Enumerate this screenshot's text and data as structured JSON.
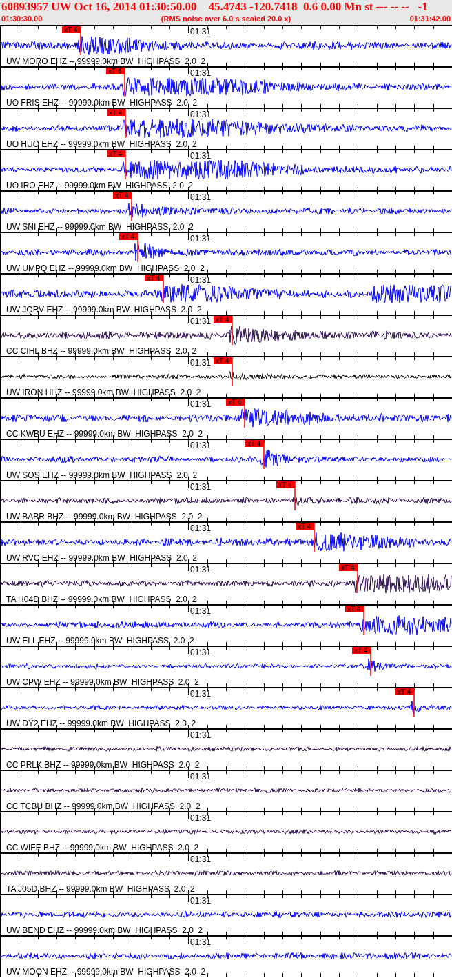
{
  "header": {
    "title": "60893957 UW Oct 16, 2014 01:30:50.00    45.4743 -120.7418  0.6 0.00 Mn st --- -- --   -1",
    "start_time": "01:30:30.00",
    "caption": "(RMS noise over 6.0 s scaled 20.0 x)",
    "end_time": "01:31:42.00"
  },
  "traces": [
    {
      "label": "UW MORO EHZ -- 99999.0km BW  HIGHPASS  2.0  2",
      "time_label": "01:31",
      "pick": "xT 4",
      "color": "#0000ff"
    },
    {
      "label": "UO FRIS EHZ -- 99999.0km BW  HIGHPASS  2.0  2",
      "time_label": "01:31",
      "pick": "xT 4",
      "color": "#0000ff"
    },
    {
      "label": "UO HUO EHZ -- 99999.0km BW  HIGHPASS  2.0  2",
      "time_label": "01:31",
      "pick": "xT 4",
      "color": "#0000ff"
    },
    {
      "label": "UO IRO EHZ -- 99999.0km BW  HIGHPASS  2.0  2",
      "time_label": "01:31",
      "pick": "xT 4",
      "color": "#0000ff"
    },
    {
      "label": "UW SNI EHZ -- 99999.0km BW  HIGHPASS  2.0  2",
      "time_label": "01:31",
      "pick": "xT 4",
      "color": "#0000ff"
    },
    {
      "label": "UW UMPQ EHZ -- 99999.0km BW  HIGHPASS  2.0  2",
      "time_label": "01:31",
      "pick": "xT 4",
      "color": "#0000ff"
    },
    {
      "label": "UW JQRV EHZ -- 99999.0km BW  HIGHPASS  2.0  2",
      "time_label": "01:31",
      "pick": "xT 4",
      "color": "#0000ff"
    },
    {
      "label": "CC CIHL BHZ -- 99999.0km BW  HIGHPASS  2.0  2",
      "time_label": "01:31",
      "pick": "xT 4",
      "color": "#2a0a50"
    },
    {
      "label": "UW IRON HHZ -- 99999.0km BW  HIGHPASS  2.0  2",
      "time_label": "01:31",
      "pick": "xT 4",
      "color": "#000000"
    },
    {
      "label": "CC KWBU EHZ -- 99999.0km BW  HIGHPASS  2.0  2",
      "time_label": "01:31",
      "pick": "xT 4",
      "color": "#0000ff"
    },
    {
      "label": "UW SOS EHZ -- 99999.0km BW  HIGHPASS  2.0  2",
      "time_label": "01:31",
      "pick": "xT 4",
      "color": "#0000ff"
    },
    {
      "label": "UW BABR BHZ -- 99999.0km BW  HIGHPASS  2.0  2",
      "time_label": "01:31",
      "pick": "xT 4",
      "color": "#2a0a50"
    },
    {
      "label": "UW RVC EHZ -- 99999.0km BW  HIGHPASS  2.0  2",
      "time_label": "01:31",
      "pick": "xT 4",
      "color": "#0000ff"
    },
    {
      "label": "TA H04D BHZ -- 99999.0km BW  HIGHPASS  2.0  2",
      "time_label": "01:31",
      "pick": "xT 4",
      "color": "#2a0a50"
    },
    {
      "label": "UW ELL EHZ -- 99999.0km BW  HIGHPASS  2.0  2",
      "time_label": "01:31",
      "pick": "xT 4",
      "color": "#0000ff"
    },
    {
      "label": "UW CPW EHZ -- 99999.0km BW  HIGHPASS  2.0  2",
      "time_label": "01:31",
      "pick": "xT 4",
      "color": "#0000ff"
    },
    {
      "label": "UW DY2 EHZ -- 99999.0km BW  HIGHPASS  2.0  2",
      "time_label": "01:31",
      "pick": "xT 4",
      "color": "#0000ff"
    },
    {
      "label": "CC PRLK BHZ -- 99999.0km BW  HIGHPASS  2.0  2",
      "time_label": "01:31",
      "color": "#2a0a50"
    },
    {
      "label": "CC TCBU BHZ -- 99999.0km BW  HIGHPASS  2.0  2",
      "time_label": "01:31",
      "color": "#2a0a50"
    },
    {
      "label": "CC WIFE BHZ -- 99999.0km BW  HIGHPASS  2.0  2",
      "time_label": "01:31",
      "color": "#2a0a50"
    },
    {
      "label": "TA J05D BHZ -- 99999.0km BW  HIGHPASS  2.0  2",
      "time_label": "01:31",
      "color": "#2a0a50"
    },
    {
      "label": "UW BEND EHZ -- 99999.0km BW  HIGHPASS  2.0  2",
      "time_label": "01:31",
      "color": "#0000ff"
    },
    {
      "label": "UW MOON EHZ -- 99999.0km BW  HIGHPASS  2.0  2",
      "time_label": "01:31",
      "color": "#0000ff"
    }
  ]
}
